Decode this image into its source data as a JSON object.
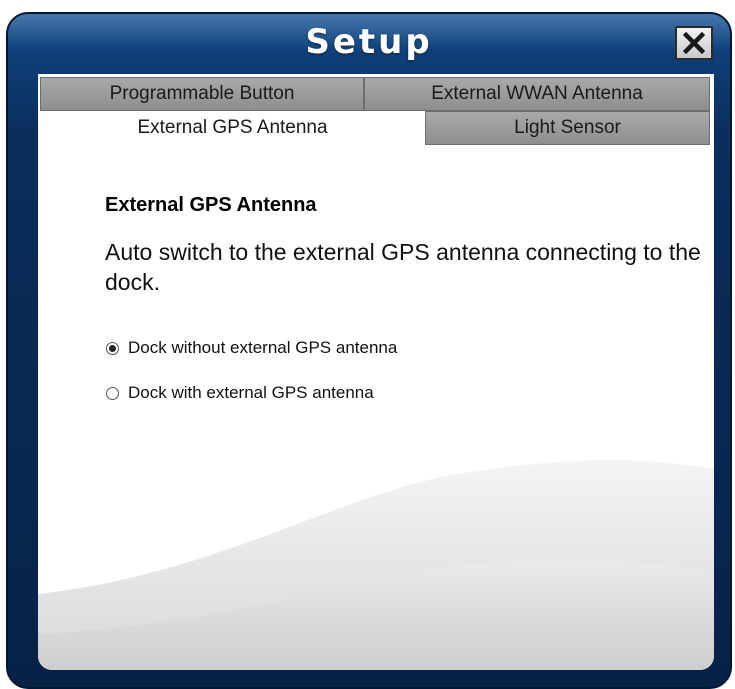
{
  "window": {
    "title": "Setup",
    "close_icon": "close-icon"
  },
  "tabs": {
    "row1": [
      {
        "label": "Programmable Button",
        "active": false
      },
      {
        "label": "External WWAN Antenna",
        "active": false
      }
    ],
    "row2": [
      {
        "label": "External GPS Antenna",
        "active": true
      },
      {
        "label": "Light Sensor",
        "active": false
      }
    ]
  },
  "content": {
    "heading": "External GPS Antenna",
    "description": "Auto switch to the external GPS antenna connecting to the dock.",
    "options": [
      {
        "label": "Dock without external GPS antenna",
        "checked": true
      },
      {
        "label": "Dock with external GPS antenna",
        "checked": false
      }
    ]
  },
  "colors": {
    "frame": "#0b2e5c",
    "tab_inactive": "#999999",
    "panel": "#ffffff"
  }
}
